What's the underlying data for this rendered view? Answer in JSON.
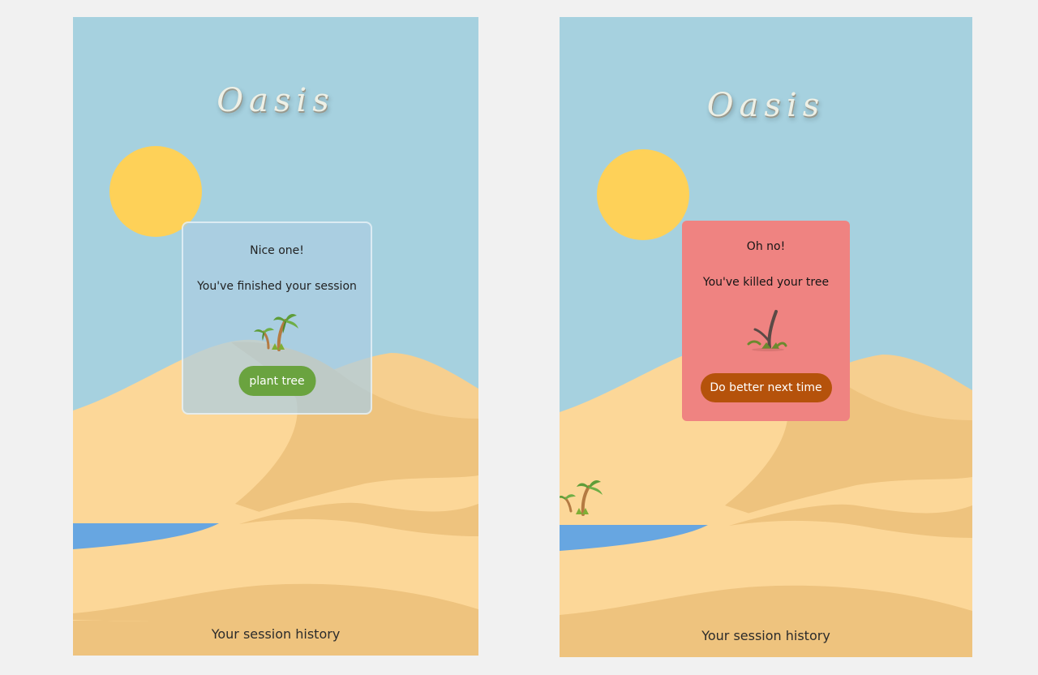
{
  "app": {
    "logo": "Oasis",
    "history_label": "Your session history"
  },
  "success_screen": {
    "heading": "Nice one!",
    "message": "You've finished your session",
    "button_label": "plant tree",
    "tree_icon": "palm-tree-icon"
  },
  "fail_screen": {
    "heading": "Oh no!",
    "message": "You've killed your tree",
    "button_label": "Do better next time",
    "tree_icon": "dead-tree-icon"
  },
  "colors": {
    "sky": "#a6d1df",
    "sun": "#fed158",
    "sand_light": "#fcd798",
    "sand_mid": "#f6cf8f",
    "sand_shadow": "#eec37e",
    "water": "#67a6e1",
    "success_card": "#acd0e2",
    "fail_card": "#ef8381",
    "plant_button": "#6aa33f",
    "fail_button": "#b5520b"
  }
}
